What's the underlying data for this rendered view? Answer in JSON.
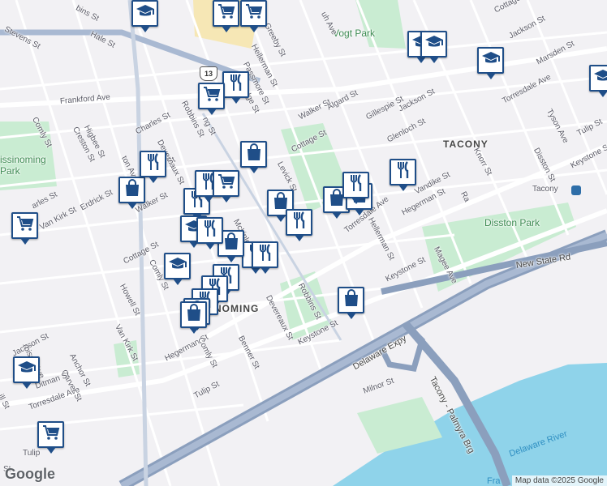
{
  "map": {
    "neighborhoods": {
      "tacony": "TACONY",
      "wissinoming": "NOMING"
    },
    "parks": {
      "vogt": "Vogt Park",
      "disston": "Disston Park",
      "wissinoming": "issinoming\nPark"
    },
    "highways": {
      "delaware_expy": "Delaware Expy",
      "new_state_rd": "New State Rd",
      "tacony_palmyra": "Tacony - Palmyra Brg",
      "route_shield": "13"
    },
    "water": {
      "delaware_river": "Delaware River",
      "fra": "Fra"
    },
    "transit": {
      "tacony_station": "Tacony"
    },
    "streets": {
      "frankford_ave": "Frankford Ave",
      "torresdale_ave_1": "Torresdale Ave",
      "torresdale_ave_2": "Torresdale Ave",
      "torresdale_ave_3": "Torresdale Ave",
      "levick_st": "Levick St",
      "robbins_st_1": "Robbins St",
      "robbins_st_2": "Robbins St",
      "cottage_st_1": "Cottage St",
      "cottage_st_2": "Cottage St",
      "cottage_st_3": "Cottage St",
      "walker_st_1": "Walker St",
      "walker_st_2": "Walker St",
      "algard_st": "Algard St",
      "gillespie_st": "Gillespie St",
      "jackson_st_1": "Jackson St",
      "jackson_st_2": "Jackson St",
      "jackson_st_3": "Jackson St",
      "glenloch_st": "Glenloch St",
      "vandike_st": "Vandike St",
      "hegerman_st_1": "Hegerman St",
      "hegerman_st_2": "Hegerman St",
      "keystone_st_1": "Keystone St",
      "keystone_st_2": "Keystone St",
      "keystone_st_3": "Keystone St",
      "tulip_st_1": "Tulip St",
      "tulip_st_2": "Tulip St",
      "tulip_st_3": "Tulip",
      "milnor_st": "Milnor St",
      "magee_ave": "Magee Ave",
      "knorr_st": "Knorr St",
      "disston_st": "Disston St",
      "tyson_ave": "Tyson Ave",
      "marsden_st": "Marsden St",
      "cottage_st_4": "Cottage St",
      "greeby_st": "Greeby St",
      "hellerman_st_1": "Hellerman St",
      "hellerman_st_2": "Hellerman St",
      "passmore_st": "Passmore St",
      "bridge_st": "bridge St",
      "devereaux_st_1": "Devereaux St",
      "devereaux_st_2": "Devereaux St",
      "charles_st_1": "Charles St",
      "charles_st_2": "arles St",
      "higbee_st": "Higbee St",
      "creston_st": "Creston St",
      "comly_st_1": "Comly St",
      "comly_st_2": "Comly St",
      "comly_st_3": "Comly St",
      "erdrick_st": "Erdrick St",
      "van_kirk_st_1": "Van Kirk St",
      "van_kirk_st_2": "Van Kirk St",
      "howell_st": "Howell St",
      "benner_st": "Benner St",
      "anchor_st": "Anchor St",
      "carver_st": "Carver St",
      "ditman_st": "Ditman St",
      "harbison_ave": "rbison Ave",
      "hale_st": "Hale St",
      "stevens_st": "Stevens St",
      "robbins_st_top": "bins St",
      "mckinley": "Mckinle",
      "rm_st": "ng St",
      "ra_st": "Ra",
      "st_short": "St",
      "rutledge": "uh Ave",
      "cottage_top": "Cottage",
      "jackson_top": "Jackson St",
      "hegerman_left": "Hegerman St",
      "otta": "ottage St",
      "les_st": "les St",
      "jackson_left": "Jackson St",
      "ill_st": "ill St",
      "ton_ave": "ton Ave"
    },
    "pins": [
      {
        "type": "school",
        "icon": "school-icon"
      },
      {
        "type": "grocery",
        "icon": "cart-icon"
      },
      {
        "type": "grocery",
        "icon": "cart-icon"
      },
      {
        "type": "school",
        "icon": "school-icon"
      },
      {
        "type": "school",
        "icon": "school-icon"
      },
      {
        "type": "school",
        "icon": "school-icon"
      },
      {
        "type": "school",
        "icon": "school-icon"
      },
      {
        "type": "restaurant",
        "icon": "fork-knife-icon"
      },
      {
        "type": "grocery",
        "icon": "cart-icon"
      },
      {
        "type": "shopping",
        "icon": "bag-icon"
      },
      {
        "type": "shopping",
        "icon": "bag-icon"
      },
      {
        "type": "restaurant",
        "icon": "fork-knife-icon"
      },
      {
        "type": "restaurant",
        "icon": "fork-knife-icon"
      },
      {
        "type": "restaurant",
        "icon": "fork-knife-icon"
      },
      {
        "type": "shopping",
        "icon": "bag-icon"
      },
      {
        "type": "grocery",
        "icon": "cart-icon"
      },
      {
        "type": "restaurant",
        "icon": "fork-knife-icon"
      },
      {
        "type": "restaurant",
        "icon": "fork-knife-icon"
      },
      {
        "type": "shopping",
        "icon": "bag-icon"
      },
      {
        "type": "shopping",
        "icon": "bag-icon"
      },
      {
        "type": "shopping",
        "icon": "bag-icon"
      },
      {
        "type": "restaurant",
        "icon": "fork-knife-icon"
      },
      {
        "type": "restaurant",
        "icon": "fork-knife-icon"
      },
      {
        "type": "school",
        "icon": "school-icon"
      },
      {
        "type": "restaurant",
        "icon": "fork-knife-icon"
      },
      {
        "type": "shopping",
        "icon": "bag-icon"
      },
      {
        "type": "restaurant",
        "icon": "fork-knife-icon"
      },
      {
        "type": "school",
        "icon": "school-icon"
      },
      {
        "type": "restaurant",
        "icon": "fork-knife-icon"
      },
      {
        "type": "restaurant",
        "icon": "fork-knife-icon"
      },
      {
        "type": "restaurant",
        "icon": "fork-knife-icon"
      },
      {
        "type": "shopping",
        "icon": "bag-icon"
      },
      {
        "type": "shopping",
        "icon": "bag-icon"
      },
      {
        "type": "school",
        "icon": "school-icon"
      },
      {
        "type": "grocery",
        "icon": "cart-icon"
      },
      {
        "type": "grocery",
        "icon": "cart-icon"
      }
    ],
    "footer": {
      "logo": "Google",
      "attribution": "Map data ©2025 Google"
    },
    "colors": {
      "land": "#f2f1f4",
      "park": "#c9ecd2",
      "water": "#8fd3ea",
      "highway": "#8b9fbd",
      "pin_border": "#1f4e88"
    }
  }
}
